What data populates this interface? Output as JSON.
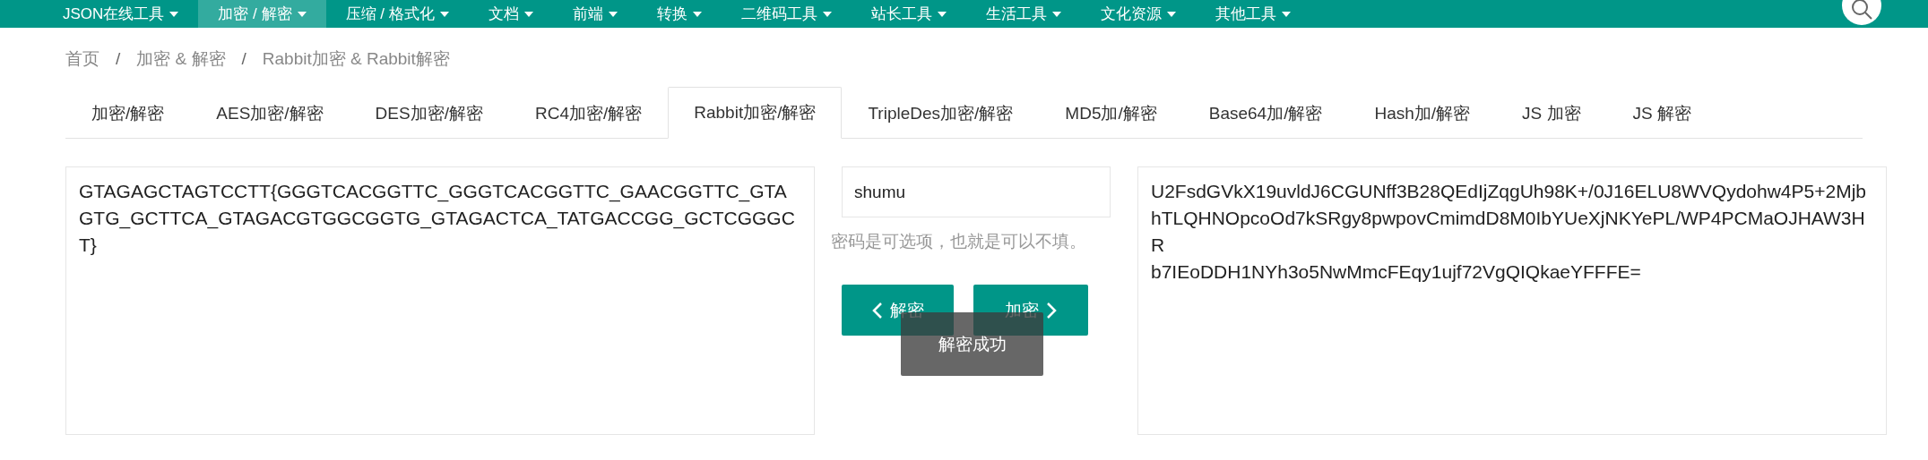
{
  "nav": {
    "items": [
      {
        "label": "JSON在线工具",
        "selected": false
      },
      {
        "label": "加密 / 解密",
        "selected": true
      },
      {
        "label": "压缩 / 格式化",
        "selected": false
      },
      {
        "label": "文档",
        "selected": false
      },
      {
        "label": "前端",
        "selected": false
      },
      {
        "label": "转换",
        "selected": false
      },
      {
        "label": "二维码工具",
        "selected": false
      },
      {
        "label": "站长工具",
        "selected": false
      },
      {
        "label": "生活工具",
        "selected": false
      },
      {
        "label": "文化资源",
        "selected": false
      },
      {
        "label": "其他工具",
        "selected": false
      }
    ]
  },
  "breadcrumb": [
    {
      "kind": "link",
      "text": "首页"
    },
    {
      "kind": "separator",
      "text": "/"
    },
    {
      "kind": "link",
      "text": "加密 & 解密"
    },
    {
      "kind": "separator",
      "text": "/"
    },
    {
      "kind": "link",
      "text": "Rabbit加密 & Rabbit解密"
    }
  ],
  "tabs": [
    {
      "label": "加密/解密",
      "selected": false
    },
    {
      "label": "AES加密/解密",
      "selected": false
    },
    {
      "label": "DES加密/解密",
      "selected": false
    },
    {
      "label": "RC4加密/解密",
      "selected": false
    },
    {
      "label": "Rabbit加密/解密",
      "selected": true
    },
    {
      "label": "TripleDes加密/解密",
      "selected": false
    },
    {
      "label": "MD5加/解密",
      "selected": false
    },
    {
      "label": "Base64加/解密",
      "selected": false
    },
    {
      "label": "Hash加/解密",
      "selected": false
    },
    {
      "label": "JS 加密",
      "selected": false
    },
    {
      "label": "JS 解密",
      "selected": false
    }
  ],
  "plaintext": "GTAGAGCTAGTCCTT{GGGTCACGGTTC_GGGTCACGGTTC_GAACGGTTC_GTAGTG_GCTTCA_GTAGACGTGGCGGTG_GTAGACTCA_TATGACCGG_GCTCGGGCT}",
  "password": {
    "value": "shumu",
    "hint": "密码是可选项，也就是可以不填。"
  },
  "buttons": [
    {
      "kind": "decrypt",
      "label": "解密"
    },
    {
      "kind": "encrypt",
      "label": "加密"
    }
  ],
  "toast": "解密成功",
  "ciphertext": "U2FsdGVkX19uvldJ6CGUNff3B28QEdIjZqgUh98K+/0J16ELU8WVQydohw4P5+2MjbhTLQHNOpcoOd7kSRgy8pwpovCmimdD8M0IbYUeXjNKYePL/WP4PCMaOJHAW3HR\nb7IEoDDH1NYh3o5NwMmcFEqy1ujf72VgQIQkaeYFFFE="
}
